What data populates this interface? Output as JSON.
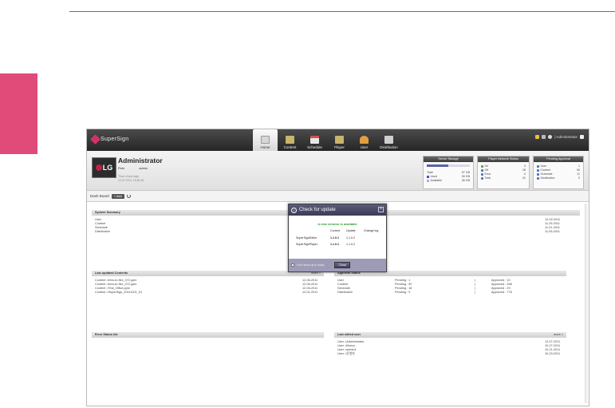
{
  "app": {
    "logo_text": "SuperSign",
    "nav": [
      {
        "label": "Home",
        "icon": "home-icon",
        "color": "#dcdcdc"
      },
      {
        "label": "Content",
        "icon": "content-icon",
        "color": "#c8b46a"
      },
      {
        "label": "Schedule",
        "icon": "schedule-icon",
        "color": "#d05050"
      },
      {
        "label": "Player",
        "icon": "player-icon",
        "color": "#c8b46a"
      },
      {
        "label": "User",
        "icon": "user-icon",
        "color": "#e0a040"
      },
      {
        "label": "Distribution",
        "icon": "distribution-icon",
        "color": "#cfcfcf"
      }
    ],
    "user_label": "| Administrator"
  },
  "profile": {
    "name": "Administrator",
    "role_label": "Role",
    "role_value": "admin",
    "login_label": "Time of last login",
    "login_time": "12-07-2011 15:45:18",
    "avatar_text": "LG"
  },
  "server_storage": {
    "title": "Server Storage",
    "used_fraction": 0.5,
    "total_label": "Total",
    "total_value": "97 GB",
    "used_label": "Used",
    "used_value": "50 GB",
    "available_label": "Available",
    "available_value": "46 GB"
  },
  "player_status": {
    "title": "Player Network Status",
    "on_label": "On",
    "on_value": "3",
    "off_label": "Off",
    "off_value": "28",
    "error_label": "Error",
    "error_value": "0",
    "total_label": "Total",
    "total_value": "31"
  },
  "pending": {
    "title": "Pending Approval",
    "user_label": "User",
    "user_value": "1",
    "content_label": "Content",
    "content_value": "90",
    "schedule_label": "Schedule",
    "schedule_value": "11",
    "distribution_label": "Distribution",
    "distribution_value": "0"
  },
  "dash": {
    "title": "Dash Board",
    "add_label": "+ Add"
  },
  "system_summary": {
    "title": "System Summary",
    "rows": [
      "User",
      "Content",
      "Schedule",
      "Distribution"
    ],
    "dates": [
      "12-02-2011",
      "11-25-2011",
      "11-21-2011",
      "11-05-2011"
    ]
  },
  "last_contents": {
    "title": "Last updated Contents",
    "more": "more >",
    "rows": [
      {
        "name": "Content >intro-to-flex_072.pptx",
        "date": "12-06-2011"
      },
      {
        "name": "Content >intro-to-flex_072.pptx",
        "date": "12-06-2011"
      },
      {
        "name": "Content >Test_Office.pptx",
        "date": "12-06-2011"
      },
      {
        "name": "Content >SuperSign_20111201_01",
        "date": "12-01-2011"
      }
    ]
  },
  "approval_status": {
    "title": "Approval status",
    "rows": [
      {
        "name": "User",
        "pending": "Pending : 1",
        "approved": "Approved : 10"
      },
      {
        "name": "Content",
        "pending": "Pending : 90",
        "approved": "Approved : 288"
      },
      {
        "name": "Schedule",
        "pending": "Pending : 18",
        "approved": "Approved : 29"
      },
      {
        "name": "Distribution",
        "pending": "Pending : 0",
        "approved": "Approved : 778"
      }
    ]
  },
  "error_status": {
    "title": "Error Status list"
  },
  "last_user": {
    "title": "Last edited user",
    "more": "more >",
    "rows": [
      {
        "name": "User >Administrator",
        "date": "12-07-2011"
      },
      {
        "name": "User >Marco",
        "date": "10-27-2011"
      },
      {
        "name": "User >admin1",
        "date": "10-21-2011"
      },
      {
        "name": "User >운영자",
        "date": "10-20-2011"
      }
    ]
  },
  "modal": {
    "title": "Check for update",
    "message": "A new version is available",
    "col_current": "Current",
    "col_update": "Update",
    "col_changelog": "Change log",
    "rows": [
      {
        "name": "SuperSignEditor",
        "current": "1.1.0.1",
        "update": "1.1.0.2"
      },
      {
        "name": "SuperSignPlayer",
        "current": "1.1.0.1",
        "update": "1.1.0.2"
      }
    ],
    "dont_show": "Don't show up to today",
    "close_label": "Close"
  }
}
